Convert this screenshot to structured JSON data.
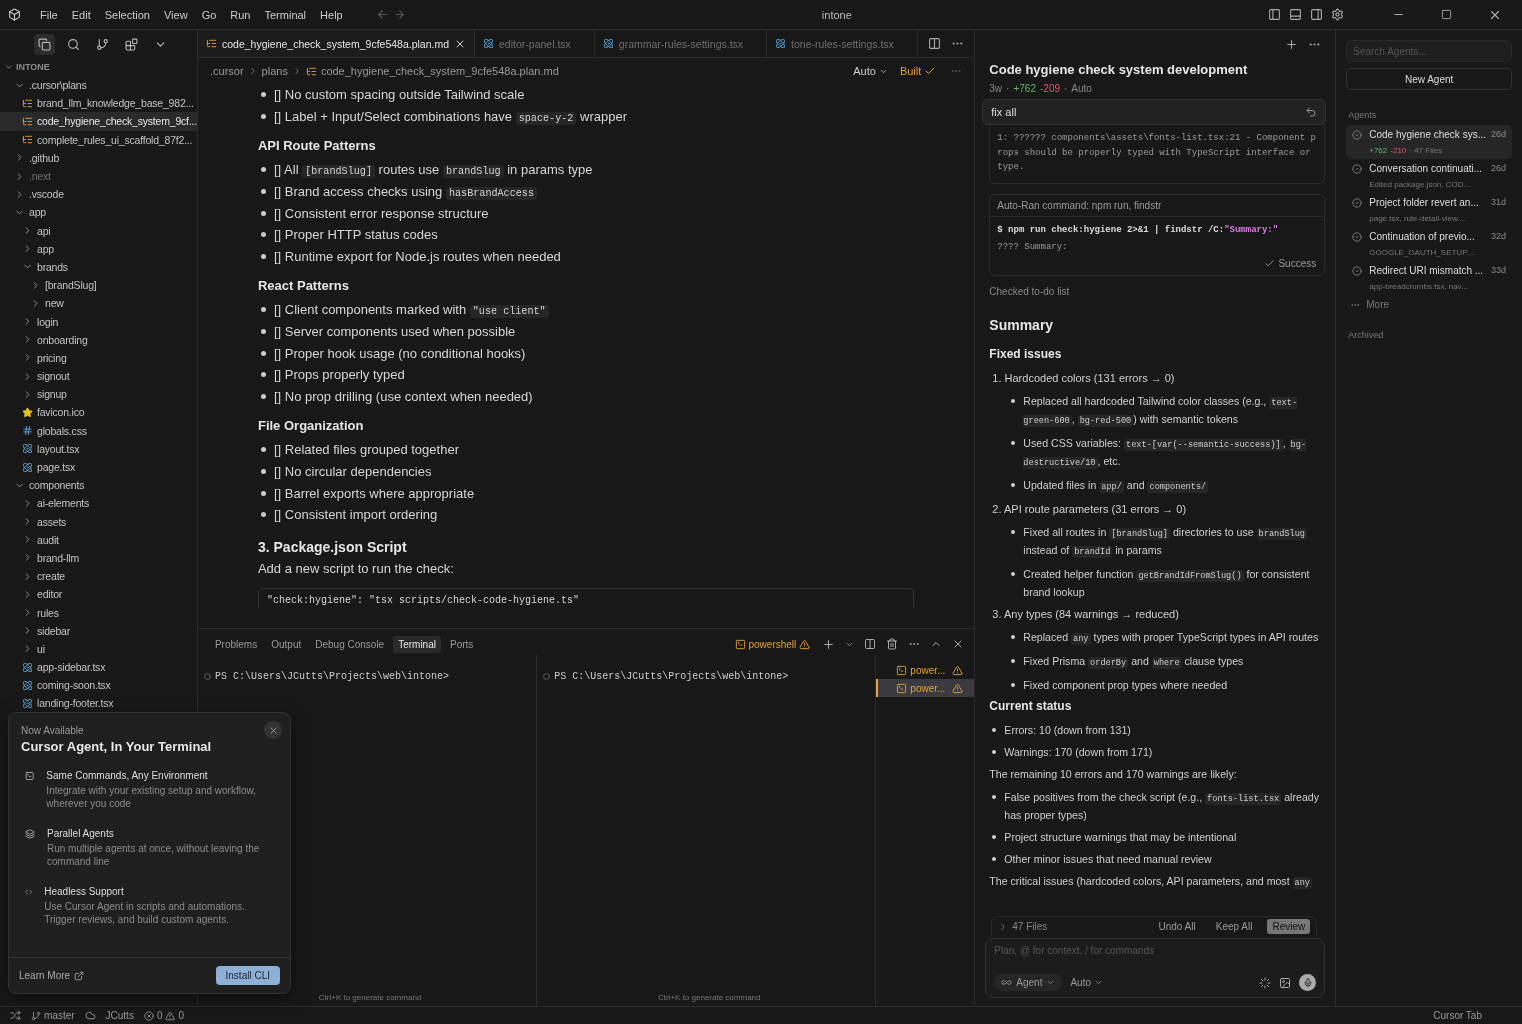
{
  "title_bar": {
    "menu": [
      "File",
      "Edit",
      "Selection",
      "View",
      "Go",
      "Run",
      "Terminal",
      "Help"
    ],
    "title": "intone"
  },
  "explorer": {
    "title": "INTONE",
    "tree": [
      {
        "name": ".cursor\\plans",
        "kind": "folder",
        "expanded": true,
        "selected": false,
        "children": [
          {
            "name": "brand_llm_knowledge_base_982...",
            "kind": "plan",
            "selected": false
          },
          {
            "name": "code_hygiene_check_system_9cf...",
            "kind": "plan",
            "selected": true
          },
          {
            "name": "complete_rules_ui_scaffold_87f2...",
            "kind": "plan",
            "selected": false
          }
        ]
      },
      {
        "name": ".github",
        "kind": "folder",
        "expanded": false,
        "selected": false
      },
      {
        "name": ".next",
        "kind": "ignored",
        "expanded": false,
        "selected": false
      },
      {
        "name": ".vscode",
        "kind": "folder",
        "expanded": false,
        "selected": false
      },
      {
        "name": "app",
        "kind": "folder",
        "expanded": true,
        "selected": false,
        "children": [
          {
            "name": "api",
            "kind": "folder",
            "expanded": false,
            "selected": false
          },
          {
            "name": "app",
            "kind": "folder",
            "expanded": false,
            "selected": false
          },
          {
            "name": "brands",
            "kind": "folder",
            "expanded": true,
            "selected": false,
            "children": [
              {
                "name": "[brandSlug]",
                "kind": "folder",
                "expanded": false,
                "selected": false
              },
              {
                "name": "new",
                "kind": "folder",
                "expanded": false,
                "selected": false
              }
            ]
          },
          {
            "name": "login",
            "kind": "folder",
            "expanded": false,
            "selected": false
          },
          {
            "name": "onboarding",
            "kind": "folder",
            "expanded": false,
            "selected": false
          },
          {
            "name": "pricing",
            "kind": "folder",
            "expanded": false,
            "selected": false
          },
          {
            "name": "signout",
            "kind": "folder",
            "expanded": false,
            "selected": false
          },
          {
            "name": "signup",
            "kind": "folder",
            "expanded": false,
            "selected": false
          },
          {
            "name": "favicon.ico",
            "kind": "star",
            "selected": false
          },
          {
            "name": "globals.css",
            "kind": "css",
            "selected": false
          },
          {
            "name": "layout.tsx",
            "kind": "react",
            "selected": false
          },
          {
            "name": "page.tsx",
            "kind": "react",
            "selected": false
          }
        ]
      },
      {
        "name": "components",
        "kind": "folder",
        "expanded": true,
        "selected": false,
        "children": [
          {
            "name": "ai-elements",
            "kind": "folder",
            "expanded": false,
            "selected": false
          },
          {
            "name": "assets",
            "kind": "folder",
            "expanded": false,
            "selected": false
          },
          {
            "name": "audit",
            "kind": "folder",
            "expanded": false,
            "selected": false
          },
          {
            "name": "brand-llm",
            "kind": "folder",
            "expanded": false,
            "selected": false
          },
          {
            "name": "create",
            "kind": "folder",
            "expanded": false,
            "selected": false
          },
          {
            "name": "editor",
            "kind": "folder",
            "expanded": false,
            "selected": false
          },
          {
            "name": "rules",
            "kind": "folder",
            "expanded": false,
            "selected": false
          },
          {
            "name": "sidebar",
            "kind": "folder",
            "expanded": false,
            "selected": false
          },
          {
            "name": "ui",
            "kind": "folder",
            "expanded": false,
            "selected": false
          },
          {
            "name": "app-sidebar.tsx",
            "kind": "react",
            "selected": false
          },
          {
            "name": "coming-soon.tsx",
            "kind": "react",
            "selected": false
          },
          {
            "name": "landing-footer.tsx",
            "kind": "react",
            "selected": false
          }
        ]
      }
    ]
  },
  "editor": {
    "tabs": [
      {
        "label": "code_hygiene_check_system_9cfe548a.plan.md",
        "kind": "plan",
        "selected": true
      },
      {
        "label": "editor-panel.tsx",
        "kind": "react",
        "selected": false
      },
      {
        "label": "grammar-rules-settings.tsx",
        "kind": "react",
        "selected": false
      },
      {
        "label": "tone-rules-settings.tsx",
        "kind": "react",
        "selected": false
      }
    ],
    "breadcrumbs": [
      ".cursor",
      "plans",
      "code_hygiene_check_system_9cfe548a.plan.md"
    ],
    "mode": "Auto",
    "build_status": "Built",
    "doc": [
      {
        "kind": "bullet",
        "parts": [
          {
            "text": "[] No custom spacing outside Tailwind scale",
            "code": false
          }
        ]
      },
      {
        "kind": "bullet",
        "parts": [
          {
            "text": "[] Label + Input/Select combinations have ",
            "code": false
          },
          {
            "text": "space-y-2",
            "code": true
          },
          {
            "text": " wrapper",
            "code": false
          }
        ]
      },
      {
        "kind": "heading",
        "parts": [
          {
            "text": "API Route Patterns",
            "code": false
          }
        ]
      },
      {
        "kind": "bullet",
        "parts": [
          {
            "text": "[] All ",
            "code": false
          },
          {
            "text": "[brandSlug]",
            "code": true
          },
          {
            "text": " routes use ",
            "code": false
          },
          {
            "text": "brandSlug",
            "code": true
          },
          {
            "text": " in params type",
            "code": false
          }
        ]
      },
      {
        "kind": "bullet",
        "parts": [
          {
            "text": "[] Brand access checks using ",
            "code": false
          },
          {
            "text": "hasBrandAccess",
            "code": true
          }
        ]
      },
      {
        "kind": "bullet",
        "parts": [
          {
            "text": "[] Consistent error response structure",
            "code": false
          }
        ]
      },
      {
        "kind": "bullet",
        "parts": [
          {
            "text": "[] Proper HTTP status codes",
            "code": false
          }
        ]
      },
      {
        "kind": "bullet",
        "parts": [
          {
            "text": "[] Runtime export for Node.js routes when needed",
            "code": false
          }
        ]
      },
      {
        "kind": "heading",
        "parts": [
          {
            "text": "React Patterns",
            "code": false
          }
        ]
      },
      {
        "kind": "bullet",
        "parts": [
          {
            "text": "[] Client components marked with ",
            "code": false
          },
          {
            "text": "\"use client\"",
            "code": true
          }
        ]
      },
      {
        "kind": "bullet",
        "parts": [
          {
            "text": "[] Server components used when possible",
            "code": false
          }
        ]
      },
      {
        "kind": "bullet",
        "parts": [
          {
            "text": "[] Proper hook usage (no conditional hooks)",
            "code": false
          }
        ]
      },
      {
        "kind": "bullet",
        "parts": [
          {
            "text": "[] Props properly typed",
            "code": false
          }
        ]
      },
      {
        "kind": "bullet",
        "parts": [
          {
            "text": "[] No prop drilling (use context when needed)",
            "code": false
          }
        ]
      },
      {
        "kind": "heading",
        "parts": [
          {
            "text": "File Organization",
            "code": false
          }
        ]
      },
      {
        "kind": "bullet",
        "parts": [
          {
            "text": "[] Related files grouped together",
            "code": false
          }
        ]
      },
      {
        "kind": "bullet",
        "parts": [
          {
            "text": "[] No circular dependencies",
            "code": false
          }
        ]
      },
      {
        "kind": "bullet",
        "parts": [
          {
            "text": "[] Barrel exports where appropriate",
            "code": false
          }
        ]
      },
      {
        "kind": "bullet",
        "parts": [
          {
            "text": "[] Consistent import ordering",
            "code": false
          }
        ]
      },
      {
        "kind": "section",
        "parts": [
          {
            "text": "3. Package.json Script",
            "code": false
          }
        ]
      },
      {
        "kind": "para",
        "parts": [
          {
            "text": "Add a new script to run the check:",
            "code": false
          }
        ]
      },
      {
        "kind": "codeblock",
        "parts": [
          {
            "text": "\"check:hygiene\": \"tsx scripts/check-code-hygiene.ts\"",
            "code": false
          }
        ]
      }
    ]
  },
  "panel": {
    "tabs": [
      {
        "label": "Problems",
        "selected": false
      },
      {
        "label": "Output",
        "selected": false
      },
      {
        "label": "Debug Console",
        "selected": false
      },
      {
        "label": "Terminal",
        "selected": true
      },
      {
        "label": "Ports",
        "selected": false
      }
    ],
    "shell": "powershell",
    "terminals": [
      {
        "prompt": "PS C:\\Users\\JCutts\\Projects\\web\\intone>",
        "hint": "Ctrl+K to generate command"
      },
      {
        "prompt": "PS C:\\Users\\JCutts\\Projects\\web\\intone>",
        "hint": "Ctrl+K to generate command"
      }
    ],
    "sessions": [
      {
        "label": "power...",
        "selected": false
      },
      {
        "label": "power...",
        "selected": true
      }
    ]
  },
  "promo": {
    "eyebrow": "Now Available",
    "title": "Cursor Agent, In Your Terminal",
    "features": [
      {
        "kind": "terminal",
        "title": "Same Commands, Any Environment",
        "text": "Integrate with your existing setup and workflow, wherever you code"
      },
      {
        "kind": "layers",
        "title": "Parallel Agents",
        "text": "Run multiple agents at once, without leaving the command line"
      },
      {
        "kind": "code",
        "title": "Headless Support",
        "text": "Use Cursor Agent in scripts and automations. Trigger reviews, and build custom agents."
      }
    ],
    "link": "Learn More",
    "button": "Install CLI"
  },
  "chat": {
    "title": "Code hygiene check system development",
    "meta": [
      {
        "text": "3w",
        "kind": "plain"
      },
      {
        "text": "·",
        "kind": "plain"
      },
      {
        "text": "+762",
        "kind": "added"
      },
      {
        "text": "-209",
        "kind": "removed"
      },
      {
        "text": "·",
        "kind": "plain"
      },
      {
        "text": "Auto",
        "kind": "plain"
      }
    ],
    "message": "fix all",
    "output": "1:   ?????? components\\assets\\fonts-list.tsx:21 - Component props should be properly typed with TypeScript interface or type.",
    "command": {
      "header": "Auto-Ran command: npm run, findstr",
      "parts": [
        {
          "text": "$ npm run check:hygiene 2>&1 | findstr /C:",
          "string": false
        },
        {
          "text": "\"Summary:\"",
          "string": true
        }
      ],
      "result": "???? Summary:",
      "status": "Success"
    },
    "note": "Checked to-do list",
    "summary": [
      {
        "kind": "h2",
        "parts": [
          {
            "text": "Summary",
            "code": false
          }
        ]
      },
      {
        "kind": "h3",
        "parts": [
          {
            "text": "Fixed issues",
            "code": false
          }
        ]
      },
      {
        "kind": "numbered",
        "marker": "1.",
        "parts": [
          {
            "text": "Hardcoded colors (131 errors → 0)",
            "code": false
          }
        ],
        "children": [
          {
            "parts": [
              {
                "text": "Replaced all hardcoded Tailwind color classes (e.g., ",
                "code": false
              },
              {
                "text": "text-green-600",
                "code": true
              },
              {
                "text": ", ",
                "code": false
              },
              {
                "text": "bg-red-500",
                "code": true
              },
              {
                "text": ") with semantic tokens",
                "code": false
              }
            ]
          },
          {
            "parts": [
              {
                "text": "Used CSS variables: ",
                "code": false
              },
              {
                "text": "text-[var(--semantic-success)]",
                "code": true
              },
              {
                "text": ", ",
                "code": false
              },
              {
                "text": "bg-destructive/10",
                "code": true
              },
              {
                "text": ", etc.",
                "code": false
              }
            ]
          },
          {
            "parts": [
              {
                "text": "Updated files in ",
                "code": false
              },
              {
                "text": "app/",
                "code": true
              },
              {
                "text": " and ",
                "code": false
              },
              {
                "text": "components/",
                "code": true
              }
            ]
          }
        ]
      },
      {
        "kind": "numbered",
        "marker": "2.",
        "parts": [
          {
            "text": "API route parameters (31 errors → 0)",
            "code": false
          }
        ],
        "children": [
          {
            "parts": [
              {
                "text": "Fixed all routes in ",
                "code": false
              },
              {
                "text": "[brandSlug]",
                "code": true
              },
              {
                "text": " directories to use ",
                "code": false
              },
              {
                "text": "brandSlug",
                "code": true
              },
              {
                "text": " instead of ",
                "code": false
              },
              {
                "text": "brandId",
                "code": true
              },
              {
                "text": " in params",
                "code": false
              }
            ]
          },
          {
            "parts": [
              {
                "text": "Created helper function ",
                "code": false
              },
              {
                "text": "getBrandIdFromSlug()",
                "code": true
              },
              {
                "text": " for consistent brand lookup",
                "code": false
              }
            ]
          }
        ]
      },
      {
        "kind": "numbered",
        "marker": "3.",
        "parts": [
          {
            "text": "Any types (84 warnings → reduced)",
            "code": false
          }
        ],
        "children": [
          {
            "parts": [
              {
                "text": "Replaced ",
                "code": false
              },
              {
                "text": "any",
                "code": true
              },
              {
                "text": " types with proper TypeScript types in API routes",
                "code": false
              }
            ]
          },
          {
            "parts": [
              {
                "text": "Fixed Prisma ",
                "code": false
              },
              {
                "text": "orderBy",
                "code": true
              },
              {
                "text": " and ",
                "code": false
              },
              {
                "text": "where",
                "code": true
              },
              {
                "text": " clause types",
                "code": false
              }
            ]
          },
          {
            "parts": [
              {
                "text": "Fixed component prop types where needed",
                "code": false
              }
            ]
          }
        ]
      },
      {
        "kind": "h3",
        "parts": [
          {
            "text": "Current status",
            "code": false
          }
        ]
      },
      {
        "kind": "bullet",
        "parts": [
          {
            "text": "Errors: 10 (down from 131)",
            "code": false
          }
        ]
      },
      {
        "kind": "bullet",
        "parts": [
          {
            "text": "Warnings: 170 (down from 171)",
            "code": false
          }
        ]
      },
      {
        "kind": "para",
        "parts": [
          {
            "text": "The remaining 10 errors and 170 warnings are likely:",
            "code": false
          }
        ]
      },
      {
        "kind": "bullet",
        "parts": [
          {
            "text": "False positives from the check script (e.g., ",
            "code": false
          },
          {
            "text": "fonts-list.tsx",
            "code": true
          },
          {
            "text": " already has proper types)",
            "code": false
          }
        ]
      },
      {
        "kind": "bullet",
        "parts": [
          {
            "text": "Project structure warnings that may be intentional",
            "code": false
          }
        ]
      },
      {
        "kind": "bullet",
        "parts": [
          {
            "text": "Other minor issues that need manual review",
            "code": false
          }
        ]
      },
      {
        "kind": "para",
        "parts": [
          {
            "text": "The critical issues (hardcoded colors, API parameters, and most ",
            "code": false
          },
          {
            "text": "any",
            "code": true
          }
        ]
      }
    ],
    "files": "47 Files",
    "undo": "Undo All",
    "keep": "Keep All",
    "review": "Review",
    "input_placeholder": "Plan, @ for context, / for commands",
    "agent_mode": "Agent",
    "agent_model": "Auto"
  },
  "agents": {
    "search_placeholder": "Search Agents...",
    "new_button": "New Agent",
    "section": "Agents",
    "items": [
      {
        "kind": "diff",
        "title": "Code hygiene check sys...",
        "age": "26d",
        "added": "+762",
        "removed": "-210",
        "files": "· 47 Files",
        "selected": true
      },
      {
        "kind": "note",
        "title": "Conversation continuati...",
        "age": "26d",
        "detail": "Edited package.json, COD...",
        "selected": false
      },
      {
        "kind": "note",
        "title": "Project folder revert an...",
        "age": "31d",
        "detail": "page.tsx, rule-detail-view....",
        "selected": false
      },
      {
        "kind": "note",
        "title": "Continuation of previo...",
        "age": "32d",
        "detail": "GOOGLE_OAUTH_SETUP....",
        "selected": false
      },
      {
        "kind": "note",
        "title": "Redirect URI mismatch ...",
        "age": "33d",
        "detail": "app-breadcrumbs.tsx, nav...",
        "selected": false
      }
    ],
    "more": "More",
    "archived": "Archived"
  },
  "status_bar": {
    "branch": "master",
    "user": "JCutts",
    "errors": "0",
    "warnings": "0",
    "right": "Cursor Tab"
  }
}
